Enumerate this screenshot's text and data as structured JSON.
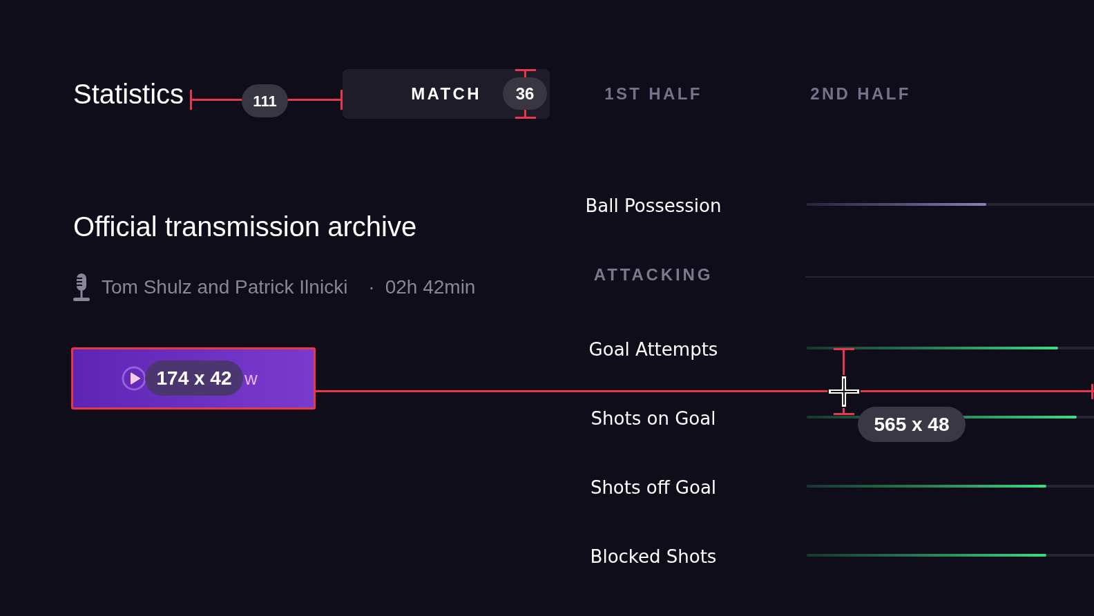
{
  "header": {
    "title": "Statistics",
    "gap_measure": "111",
    "tabs": [
      {
        "label": "MATCH",
        "selected": true,
        "height_measure": "36"
      },
      {
        "label": "1ST HALF",
        "selected": false
      },
      {
        "label": "2ND HALF",
        "selected": false
      }
    ]
  },
  "broadcast": {
    "title": "Official transmission archive",
    "commentators": "Tom Shulz and Patrick Ilnicki",
    "separator": "·",
    "duration": "02h 42min",
    "button": {
      "label": "w",
      "size_measure": "174 x 42"
    }
  },
  "stats": [
    {
      "kind": "bar",
      "label": "Ball Possession",
      "level": 0.625,
      "color": "#8b80b8"
    },
    {
      "kind": "section",
      "label": "ATTACKING"
    },
    {
      "kind": "bar",
      "label": "Goal Attempts",
      "level": 0.875,
      "color": "#3ddc84"
    },
    {
      "kind": "bar",
      "label": "Shots on Goal",
      "level": 0.94,
      "color": "#3ddc84"
    },
    {
      "kind": "bar",
      "label": "Shots off Goal",
      "level": 0.834,
      "color": "#3ddc84"
    },
    {
      "kind": "bar",
      "label": "Blocked Shots",
      "level": 0.834,
      "color": "#3ddc84"
    }
  ],
  "cursor": {
    "size_measure": "565 x 48"
  }
}
